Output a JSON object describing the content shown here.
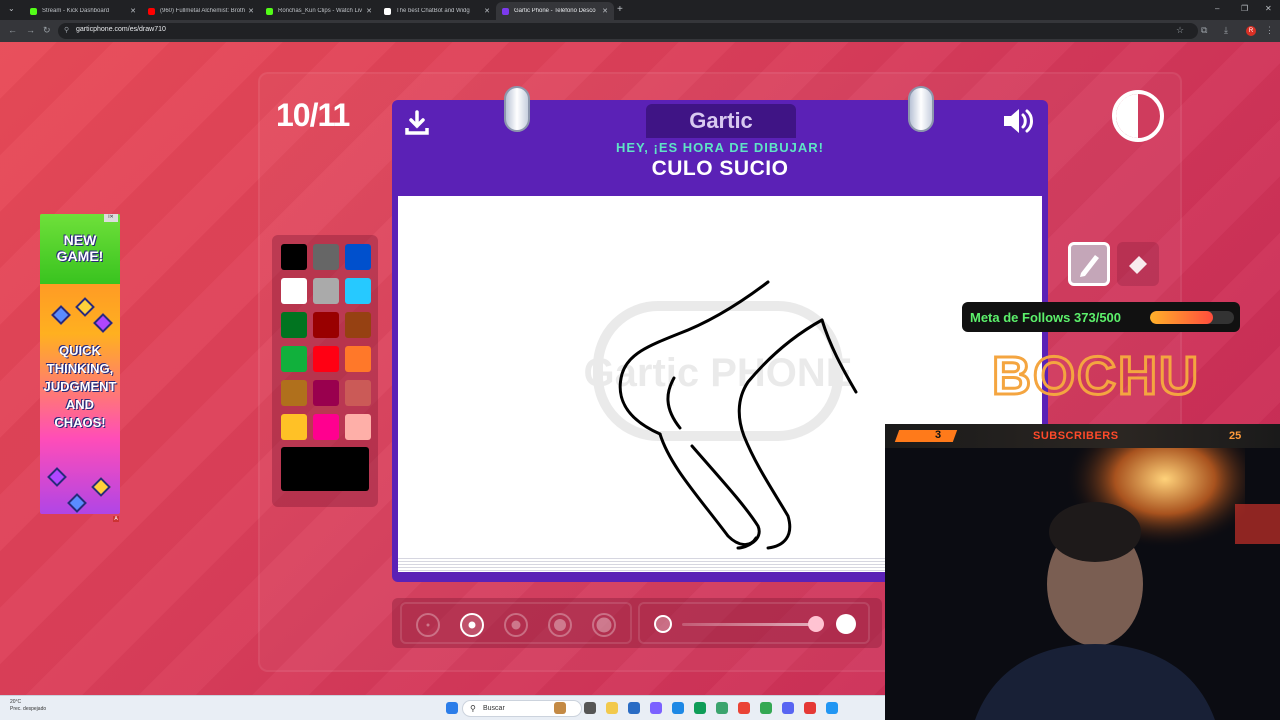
{
  "browser": {
    "tabs": [
      {
        "title": "Stream - Kick Dashboard",
        "favicon_color": "#53fc18"
      },
      {
        "title": "(960) Fullmetal Alchemist: Broth",
        "favicon_color": "#ff0000"
      },
      {
        "title": "Ronchas_Kun Clips - Watch Liv",
        "favicon_color": "#53fc18"
      },
      {
        "title": "The best ChatBot and Widg",
        "favicon_color": "#ffffff"
      },
      {
        "title": "Gartic Phone - Teléfono Desco",
        "favicon_color": "#7c3aed"
      }
    ],
    "active_tab": 4,
    "url": "garticphone.com/es/draw710",
    "profile_badge": "R"
  },
  "game": {
    "counter": "10/11",
    "logo": "Gartic",
    "prompt_header": "HEY, ¡ES HORA DE DIBUJAR!",
    "prompt_word": "CULO SUCIO",
    "watermark": "Gartic PHONE"
  },
  "palette": {
    "colors": [
      "#000000",
      "#666666",
      "#0050cd",
      "#ffffff",
      "#aaaaaa",
      "#26c9ff",
      "#017420",
      "#990000",
      "#964112",
      "#11b03c",
      "#ff0013",
      "#ff7829",
      "#b0701c",
      "#99004e",
      "#cb5a57",
      "#ffc126",
      "#ff008f",
      "#feafa8"
    ],
    "current_color": "#000000"
  },
  "tools": {
    "selected": "pen",
    "items": [
      "pen",
      "eraser"
    ]
  },
  "brush": {
    "sizes": 5,
    "selected_size_index": 1
  },
  "ad": {
    "headline": "NEW GAME!",
    "body": "QUICK THINKING, JUDGMENT AND CHAOS!"
  },
  "overlay": {
    "meta_label": "Meta de Follows 373/500",
    "follows_current": 373,
    "follows_goal": 500,
    "brand": "BOCHU",
    "subs_badge_num": "3",
    "subs_label": "SUBSCRIBERS",
    "subs_count": "25"
  },
  "taskbar": {
    "weather_temp": "20°C",
    "weather_desc": "Prec. despejado",
    "search_label": "Buscar"
  }
}
